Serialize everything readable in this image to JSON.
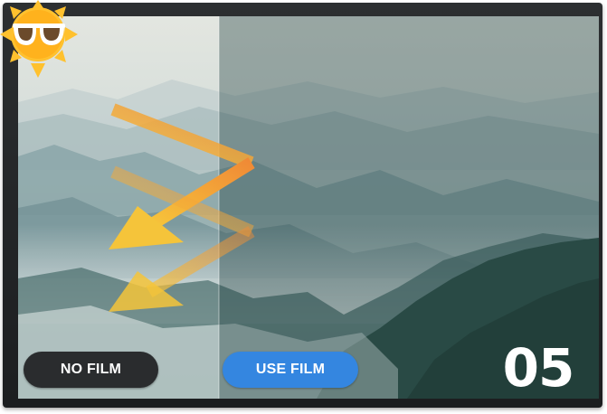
{
  "buttons": {
    "no_film_label": "NO FILM",
    "use_film_label": "USE FILM"
  },
  "step": {
    "number": "05"
  },
  "icons": {
    "logo": "sun-with-sunglasses-icon",
    "arrows": "sunlight-arrow-icon"
  },
  "colors": {
    "no_film_button": "#2a2c2e",
    "use_film_button": "#3486e0",
    "arrow_orange": "#f29a3c",
    "arrow_yellow": "#f5c33a",
    "logo_sun": "#ffc12e",
    "film_tint": "#203e40"
  }
}
